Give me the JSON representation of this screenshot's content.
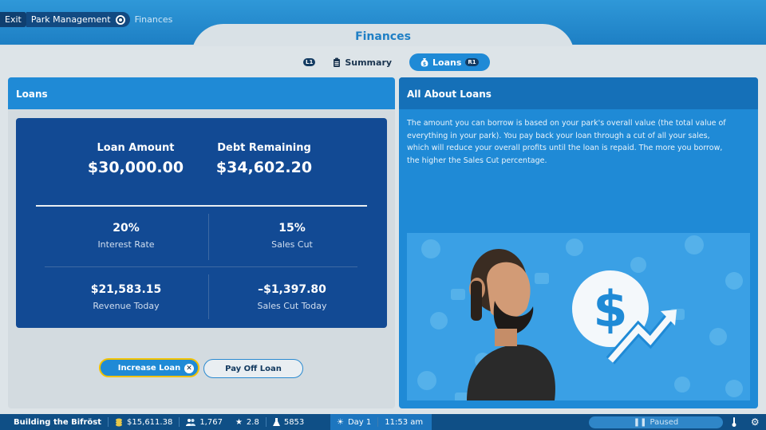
{
  "breadcrumb": {
    "exit": "Exit",
    "park_management": "Park Management",
    "finances": "Finances"
  },
  "page_title": "Finances",
  "tabs": {
    "left_bumper": "L1",
    "right_bumper": "R1",
    "summary": "Summary",
    "loans": "Loans",
    "active": "Loans"
  },
  "loans_panel": {
    "title": "Loans",
    "loan_amount_label": "Loan Amount",
    "loan_amount": "$30,000.00",
    "debt_remaining_label": "Debt Remaining",
    "debt_remaining": "$34,602.20",
    "interest_rate": "20%",
    "interest_rate_label": "Interest Rate",
    "sales_cut": "15%",
    "sales_cut_label": "Sales Cut",
    "revenue_today": "$21,583.15",
    "revenue_today_label": "Revenue Today",
    "sales_cut_today": "–$1,397.80",
    "sales_cut_today_label": "Sales Cut Today",
    "increase_button": "Increase Loan",
    "payoff_button": "Pay Off Loan"
  },
  "about_panel": {
    "title": "All About Loans",
    "body": "The amount you can borrow is based on your park's overall value (the total value of everything in your park). You pay back your loan through a cut of all your sales, which will reduce your overall profits until the loan is repaid. The more you borrow, the higher the Sales Cut percentage."
  },
  "status_bar": {
    "park_name": "Building the Bifröst",
    "money": "$15,611.38",
    "guests": "1,767",
    "rating": "2.8",
    "research": "5853",
    "day": "Day 1",
    "time": "11:53 am",
    "pause_state": "Paused"
  },
  "colors": {
    "accent_blue": "#1f8ad6",
    "card_navy": "#124a94",
    "focus_yellow": "#f2c200",
    "background": "#d9e1e6"
  }
}
